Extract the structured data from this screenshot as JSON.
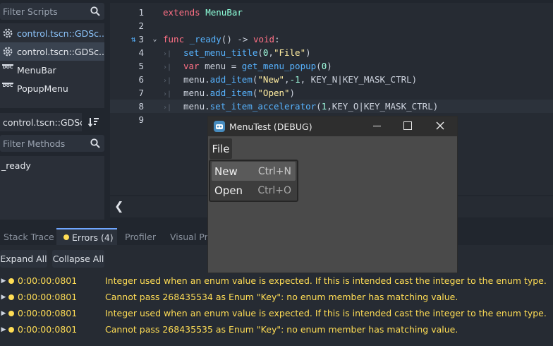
{
  "scripts_panel": {
    "filter_placeholder": "Filter Scripts",
    "items": [
      {
        "label": "control.tscn::GDSc...",
        "icon": "gear-icon",
        "selected": false
      },
      {
        "label": "control.tscn::GDSc...",
        "icon": "gear-icon",
        "selected": true
      },
      {
        "label": "MenuBar",
        "icon": "doc-icon",
        "selected": false
      },
      {
        "label": "PopupMenu",
        "icon": "doc-icon",
        "selected": false
      }
    ]
  },
  "methods_panel": {
    "current_script": "control.tscn::GDScri",
    "filter_placeholder": "Filter Methods",
    "methods": [
      "_ready"
    ]
  },
  "editor": {
    "icon_glyphs": {
      "tab": "›|",
      "fold": "⌄",
      "connection": "⇅"
    },
    "lines": [
      {
        "num": "1",
        "tokens": [
          {
            "t": "extends",
            "c": "kw"
          },
          {
            "t": " ",
            "c": "tx"
          },
          {
            "t": "MenuBar",
            "c": "ty"
          }
        ]
      },
      {
        "num": "2",
        "tokens": []
      },
      {
        "num": "3",
        "tokens": [
          {
            "t": "func",
            "c": "kw"
          },
          {
            "t": " ",
            "c": "tx"
          },
          {
            "t": "_ready",
            "c": "fn"
          },
          {
            "t": "() -> ",
            "c": "tx"
          },
          {
            "t": "void",
            "c": "kw"
          },
          {
            "t": ":",
            "c": "tx"
          }
        ]
      },
      {
        "num": "4",
        "tokens": [
          {
            "t": "set_menu_title",
            "c": "fn"
          },
          {
            "t": "(",
            "c": "tx"
          },
          {
            "t": "0",
            "c": "nu"
          },
          {
            "t": ",",
            "c": "tx"
          },
          {
            "t": "\"File\"",
            "c": "st"
          },
          {
            "t": ")",
            "c": "tx"
          }
        ]
      },
      {
        "num": "5",
        "tokens": [
          {
            "t": "var",
            "c": "kw"
          },
          {
            "t": " menu = ",
            "c": "tx"
          },
          {
            "t": "get_menu_popup",
            "c": "fn"
          },
          {
            "t": "(",
            "c": "tx"
          },
          {
            "t": "0",
            "c": "nu"
          },
          {
            "t": ")",
            "c": "tx"
          }
        ]
      },
      {
        "num": "6",
        "tokens": [
          {
            "t": "menu.",
            "c": "tx"
          },
          {
            "t": "add_item",
            "c": "fn"
          },
          {
            "t": "(",
            "c": "tx"
          },
          {
            "t": "\"New\"",
            "c": "st"
          },
          {
            "t": ",",
            "c": "tx"
          },
          {
            "t": "-1",
            "c": "nu"
          },
          {
            "t": ", KEY_N|KEY_MASK_CTRL)",
            "c": "tx"
          }
        ]
      },
      {
        "num": "7",
        "tokens": [
          {
            "t": "menu.",
            "c": "tx"
          },
          {
            "t": "add_item",
            "c": "fn"
          },
          {
            "t": "(",
            "c": "tx"
          },
          {
            "t": "\"Open\"",
            "c": "st"
          },
          {
            "t": ")",
            "c": "tx"
          }
        ]
      },
      {
        "num": "8",
        "tokens": [
          {
            "t": "menu.",
            "c": "tx"
          },
          {
            "t": "set_item_accelerator",
            "c": "fn"
          },
          {
            "t": "(",
            "c": "tx"
          },
          {
            "t": "1",
            "c": "nu"
          },
          {
            "t": ",KEY_O|KEY_MASK_CTRL)",
            "c": "tx"
          }
        ]
      },
      {
        "num": "9",
        "tokens": []
      }
    ]
  },
  "bottom_panel": {
    "tabs": [
      "Stack Trace",
      "Errors (4)",
      "Profiler",
      "Visual Pro"
    ],
    "active_tab": 1,
    "expand_all": "Expand All",
    "collapse_all": "Collapse All",
    "errors": [
      {
        "time": "0:00:00:0801",
        "message": "Integer used when an enum value is expected. If this is intended cast the integer to the enum type."
      },
      {
        "time": "0:00:00:0801",
        "message": "Cannot pass 268435534 as Enum \"Key\": no enum member has matching value."
      },
      {
        "time": "0:00:00:0801",
        "message": "Integer used when an enum value is expected. If this is intended cast the integer to the enum type."
      },
      {
        "time": "0:00:00:0801",
        "message": "Cannot pass 268435535 as Enum \"Key\": no enum member has matching value."
      }
    ]
  },
  "debug_window": {
    "title": "MenuTest (DEBUG)",
    "menu_title": "File",
    "items": [
      {
        "label": "New",
        "accel": "Ctrl+N"
      },
      {
        "label": "Open",
        "accel": "Ctrl+O"
      }
    ]
  },
  "colors": {
    "accent": "#6fa6ff",
    "warning": "#ffdd55",
    "keyword": "#ff7085",
    "function": "#57b3ff",
    "string": "#ffeda1"
  }
}
